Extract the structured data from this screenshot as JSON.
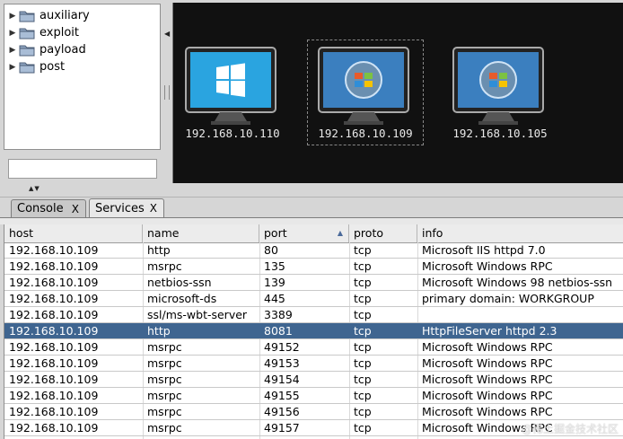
{
  "module_tree": [
    {
      "label": "auxiliary"
    },
    {
      "label": "exploit"
    },
    {
      "label": "payload"
    },
    {
      "label": "post"
    }
  ],
  "search": {
    "value": ""
  },
  "targets": [
    {
      "ip": "192.168.10.110",
      "os_icon": "windows-10-icon",
      "selected": false
    },
    {
      "ip": "192.168.10.109",
      "os_icon": "windows-vista-icon",
      "selected": true
    },
    {
      "ip": "192.168.10.105",
      "os_icon": "windows-vista-icon",
      "selected": false
    }
  ],
  "tabs": [
    {
      "label": "Console",
      "close": "X"
    },
    {
      "label": "Services",
      "close": "X"
    }
  ],
  "services": {
    "columns": [
      "host",
      "name",
      "port",
      "proto",
      "info"
    ],
    "sort_column": "port",
    "rows": [
      {
        "host": "192.168.10.109",
        "name": "http",
        "port": "80",
        "proto": "tcp",
        "info": "Microsoft IIS httpd 7.0"
      },
      {
        "host": "192.168.10.109",
        "name": "msrpc",
        "port": "135",
        "proto": "tcp",
        "info": "Microsoft Windows RPC"
      },
      {
        "host": "192.168.10.109",
        "name": "netbios-ssn",
        "port": "139",
        "proto": "tcp",
        "info": "Microsoft Windows 98 netbios-ssn"
      },
      {
        "host": "192.168.10.109",
        "name": "microsoft-ds",
        "port": "445",
        "proto": "tcp",
        "info": "primary domain: WORKGROUP"
      },
      {
        "host": "192.168.10.109",
        "name": "ssl/ms-wbt-server",
        "port": "3389",
        "proto": "tcp",
        "info": ""
      },
      {
        "host": "192.168.10.109",
        "name": "http",
        "port": "8081",
        "proto": "tcp",
        "info": "HttpFileServer httpd 2.3"
      },
      {
        "host": "192.168.10.109",
        "name": "msrpc",
        "port": "49152",
        "proto": "tcp",
        "info": "Microsoft Windows RPC"
      },
      {
        "host": "192.168.10.109",
        "name": "msrpc",
        "port": "49153",
        "proto": "tcp",
        "info": "Microsoft Windows RPC"
      },
      {
        "host": "192.168.10.109",
        "name": "msrpc",
        "port": "49154",
        "proto": "tcp",
        "info": "Microsoft Windows RPC"
      },
      {
        "host": "192.168.10.109",
        "name": "msrpc",
        "port": "49155",
        "proto": "tcp",
        "info": "Microsoft Windows RPC"
      },
      {
        "host": "192.168.10.109",
        "name": "msrpc",
        "port": "49156",
        "proto": "tcp",
        "info": "Microsoft Windows RPC"
      },
      {
        "host": "192.168.10.109",
        "name": "msrpc",
        "port": "49157",
        "proto": "tcp",
        "info": "Microsoft Windows RPC"
      }
    ],
    "selected_row": 5
  },
  "colors": {
    "selection": "#3f6590",
    "canvas": "#111111"
  },
  "watermark": "@稀土掘金技术社区"
}
